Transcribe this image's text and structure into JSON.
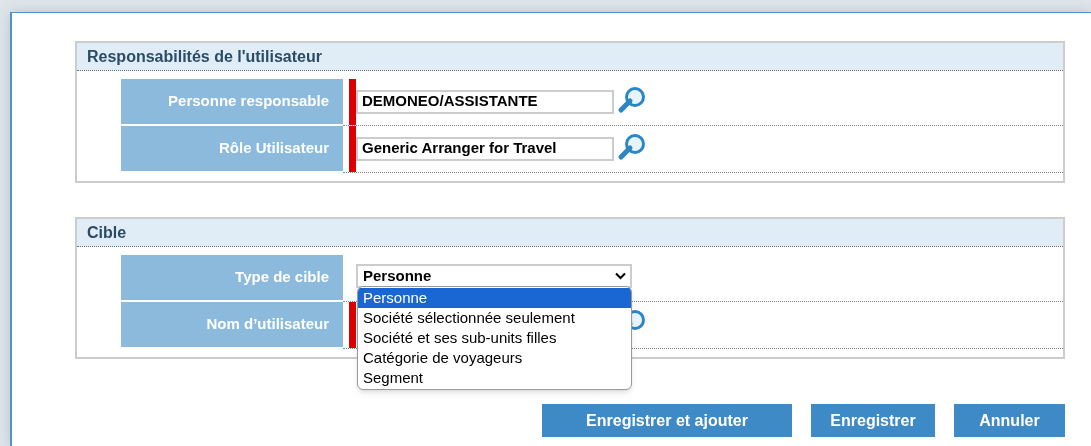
{
  "sections": [
    {
      "title": "Responsabilités de l'utilisateur",
      "rows": [
        {
          "label": "Personne responsable",
          "kind": "lookup",
          "required": true,
          "value": "DEMONEO/ASSISTANTE"
        },
        {
          "label": "Rôle Utilisateur",
          "kind": "lookup",
          "required": true,
          "value": "Generic Arranger for Travel"
        }
      ]
    },
    {
      "title": "Cible",
      "rows": [
        {
          "label": "Type de cible",
          "kind": "select",
          "required": false,
          "value": "Personne",
          "expanded": true,
          "options": [
            {
              "label": "Personne",
              "selected": true
            },
            {
              "label": "Société sélectionnée seulement",
              "selected": false
            },
            {
              "label": "Société et ses sub-units filles",
              "selected": false
            },
            {
              "label": "Catégorie de voyageurs",
              "selected": false
            },
            {
              "label": "Segment",
              "selected": false
            }
          ]
        },
        {
          "label": "Nom d’utilisateur",
          "kind": "lookup",
          "required": true
        }
      ]
    }
  ],
  "buttons": [
    "Enregistrer et ajouter",
    "Enregistrer",
    "Annuler"
  ]
}
